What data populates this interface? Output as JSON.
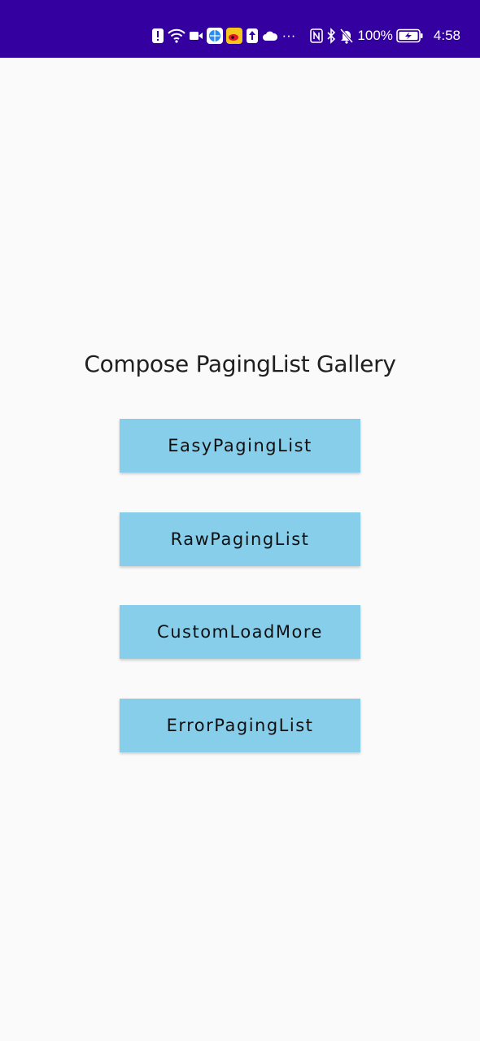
{
  "status_bar": {
    "background": "#3500a0",
    "icons": [
      "alert-icon",
      "wifi-icon",
      "video-icon",
      "browser-icon",
      "weibo-icon",
      "upload-icon",
      "cloud-icon",
      "more-icon",
      "nfc-icon",
      "bluetooth-icon",
      "mute-icon"
    ],
    "more": "···",
    "battery_percent": "100%",
    "time": "4:58"
  },
  "main": {
    "title": "Compose PagingList Gallery",
    "button_color": "#87ceeb",
    "buttons": [
      {
        "label": "EasyPagingList"
      },
      {
        "label": "RawPagingList"
      },
      {
        "label": "CustomLoadMore"
      },
      {
        "label": "ErrorPagingList"
      }
    ]
  }
}
